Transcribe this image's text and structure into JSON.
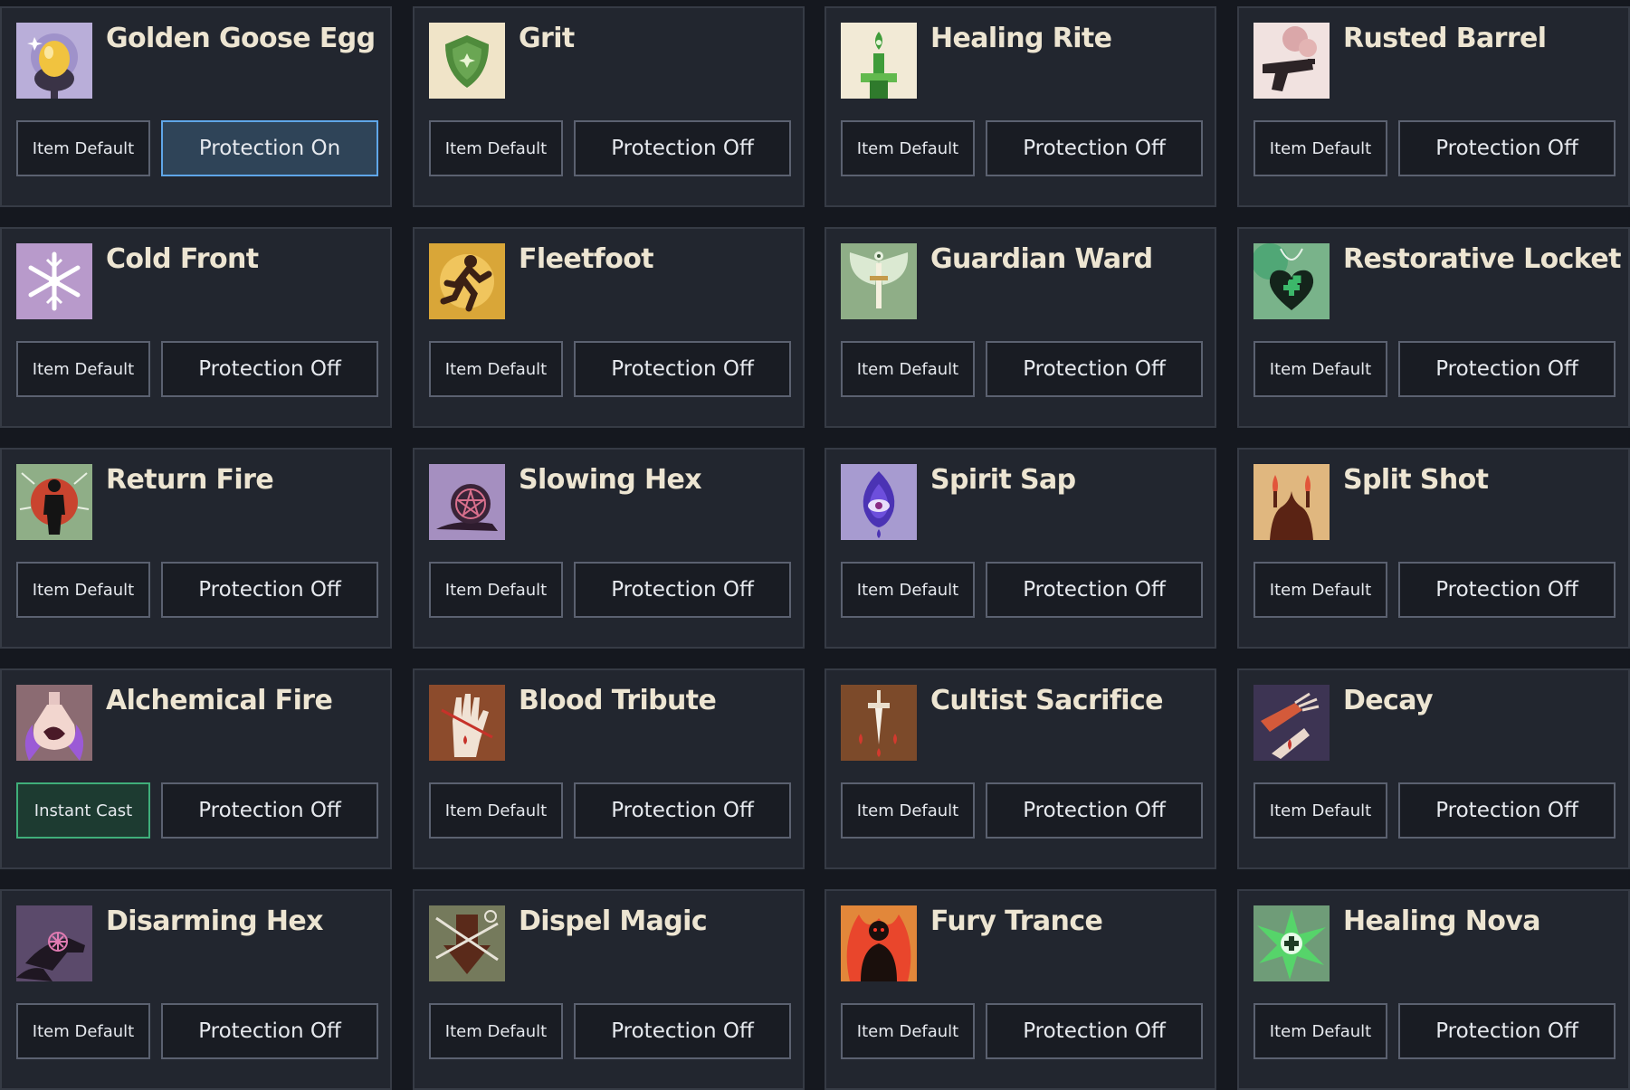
{
  "colors": {
    "background": "#15181f",
    "card": "#22262f",
    "card_border": "#363b45",
    "title_text": "#ede5d2",
    "button_border": "#5b6170",
    "protection_on_fill": "#2f4458",
    "protection_on_border": "#5fa6e8",
    "instant_cast_fill": "#1d3b31",
    "instant_cast_border": "#3fae7a"
  },
  "cards": [
    {
      "title": "Golden Goose Egg",
      "icon": "golden-egg-nest-icon",
      "mode": "Item Default",
      "protection": "Protection On",
      "protection_on": true
    },
    {
      "title": "Grit",
      "icon": "shield-icon",
      "mode": "Item Default",
      "protection": "Protection Off"
    },
    {
      "title": "Healing Rite",
      "icon": "green-candle-icon",
      "mode": "Item Default",
      "protection": "Protection Off"
    },
    {
      "title": "Rusted Barrel",
      "icon": "smoking-pistol-icon",
      "mode": "Item Default",
      "protection": "Protection Off"
    },
    {
      "title": "Cold Front",
      "icon": "snowflake-icon",
      "mode": "Item Default",
      "protection": "Protection Off"
    },
    {
      "title": "Fleetfoot",
      "icon": "running-figure-icon",
      "mode": "Item Default",
      "protection": "Protection Off"
    },
    {
      "title": "Guardian Ward",
      "icon": "winged-sword-icon",
      "mode": "Item Default",
      "protection": "Protection Off"
    },
    {
      "title": "Restorative Locket",
      "icon": "heart-locket-icon",
      "mode": "Item Default",
      "protection": "Protection Off"
    },
    {
      "title": "Return Fire",
      "icon": "silhouette-burst-icon",
      "mode": "Item Default",
      "protection": "Protection Off"
    },
    {
      "title": "Slowing Hex",
      "icon": "pentagram-snail-icon",
      "mode": "Item Default",
      "protection": "Protection Off"
    },
    {
      "title": "Spirit Sap",
      "icon": "spirit-eye-flame-icon",
      "mode": "Item Default",
      "protection": "Protection Off"
    },
    {
      "title": "Split Shot",
      "icon": "split-flame-hands-icon",
      "mode": "Item Default",
      "protection": "Protection Off"
    },
    {
      "title": "Alchemical Fire",
      "icon": "fire-flask-icon",
      "mode": "Instant Cast",
      "protection": "Protection Off",
      "instant_cast": true
    },
    {
      "title": "Blood Tribute",
      "icon": "bleeding-hand-icon",
      "mode": "Item Default",
      "protection": "Protection Off"
    },
    {
      "title": "Cultist Sacrifice",
      "icon": "dagger-blood-icon",
      "mode": "Item Default",
      "protection": "Protection Off"
    },
    {
      "title": "Decay",
      "icon": "decaying-hands-icon",
      "mode": "Item Default",
      "protection": "Protection Off"
    },
    {
      "title": "Disarming Hex",
      "icon": "hex-hand-icon",
      "mode": "Item Default",
      "protection": "Protection Off"
    },
    {
      "title": "Dispel Magic",
      "icon": "dispel-arrow-icon",
      "mode": "Item Default",
      "protection": "Protection Off"
    },
    {
      "title": "Fury Trance",
      "icon": "raging-figure-icon",
      "mode": "Item Default",
      "protection": "Protection Off"
    },
    {
      "title": "Healing Nova",
      "icon": "healing-burst-icon",
      "mode": "Item Default",
      "protection": "Protection Off"
    }
  ]
}
